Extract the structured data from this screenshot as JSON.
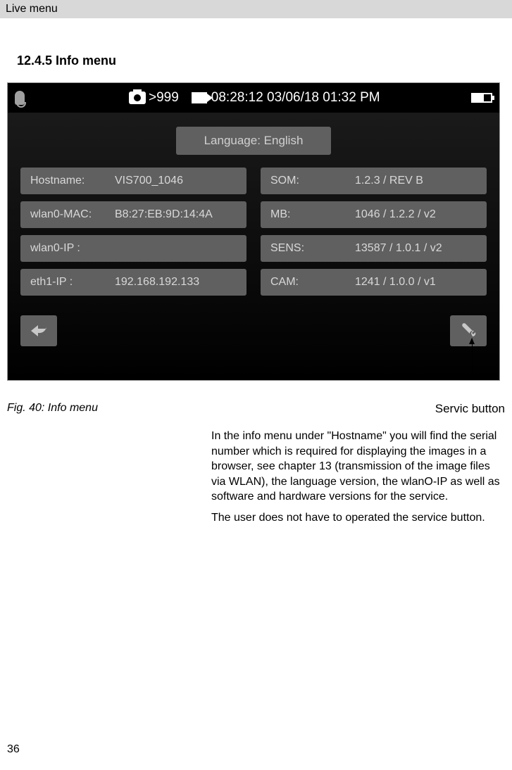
{
  "header": "Live menu",
  "section_title": "12.4.5 Info menu",
  "status_bar": {
    "counter": ">999",
    "timestamp": "08:28:12 03/06/18 01:32 PM"
  },
  "language_button": "Language: English",
  "info_cells": {
    "hostname_label": "Hostname:",
    "hostname_value": "VIS700_1046",
    "som_label": "SOM:",
    "som_value": "1.2.3 / REV B",
    "wlan_mac_label": "wlan0-MAC:",
    "wlan_mac_value": "B8:27:EB:9D:14:4A",
    "mb_label": "MB:",
    "mb_value": "1046 / 1.2.2 / v2",
    "wlan_ip_label": "wlan0-IP :",
    "wlan_ip_value": "",
    "sens_label": "SENS:",
    "sens_value": "13587 / 1.0.1 / v2",
    "eth_ip_label": "eth1-IP :",
    "eth_ip_value": "192.168.192.133",
    "cam_label": "CAM:",
    "cam_value": "1241 / 1.0.0 / v1"
  },
  "servic_label": "Servic button",
  "fig_caption": "Fig. 40: Info menu",
  "body_para1": "In the info menu under \"Hostname\" you will find the serial number which is required for displaying the images in a browser, see chapter 13 (transmission of the image files via WLAN), the language version, the wlanO-IP as well as software and hardware versions for the service.",
  "body_para2": "The user does not have to operated the service button.",
  "page_num": "36"
}
